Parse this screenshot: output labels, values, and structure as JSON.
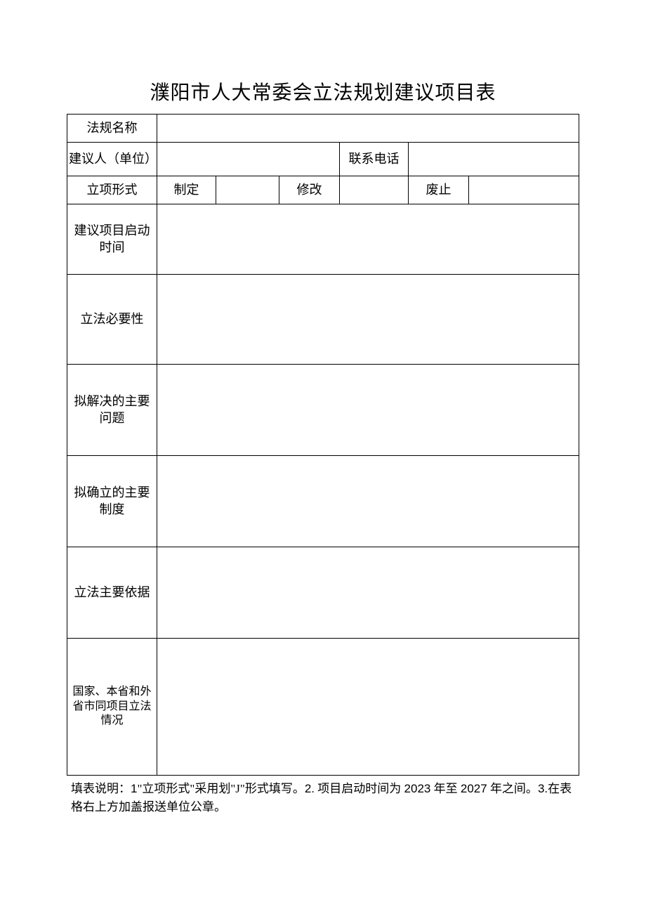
{
  "title": "濮阳市人大常委会立法规划建议项目表",
  "labels": {
    "regulation_name": "法规名称",
    "proposer": "建议人（单位）",
    "contact_phone": "联系电话",
    "project_type": "立项形式",
    "type_enact": "制定",
    "type_amend": "修改",
    "type_repeal": "废止",
    "start_time": "建议项目启动时间",
    "necessity": "立法必要性",
    "problems": "拟解决的主要问题",
    "systems": "拟确立的主要制度",
    "basis": "立法主要依据",
    "other_status": "国家、本省和外省市同项目立法情况"
  },
  "values": {
    "regulation_name": "",
    "proposer": "",
    "contact_phone": "",
    "type_enact_mark": "",
    "type_amend_mark": "",
    "type_repeal_mark": "",
    "start_time": "",
    "necessity": "",
    "problems": "",
    "systems": "",
    "basis": "",
    "other_status": ""
  },
  "instructions": {
    "prefix": "填表说明：",
    "part1_num": "1",
    "part1_text": "\"立项形式\"采用划\"J\"形式填写。",
    "part2_num": "2.",
    "part2_text_a": " 项目启动时间为 ",
    "year1": "2023",
    "mid": " 年至 ",
    "year2": "2027",
    "part2_text_b": " 年之间。",
    "part3_num": "3.",
    "part3_text": "在表格右上方加盖报送单位公章。"
  }
}
